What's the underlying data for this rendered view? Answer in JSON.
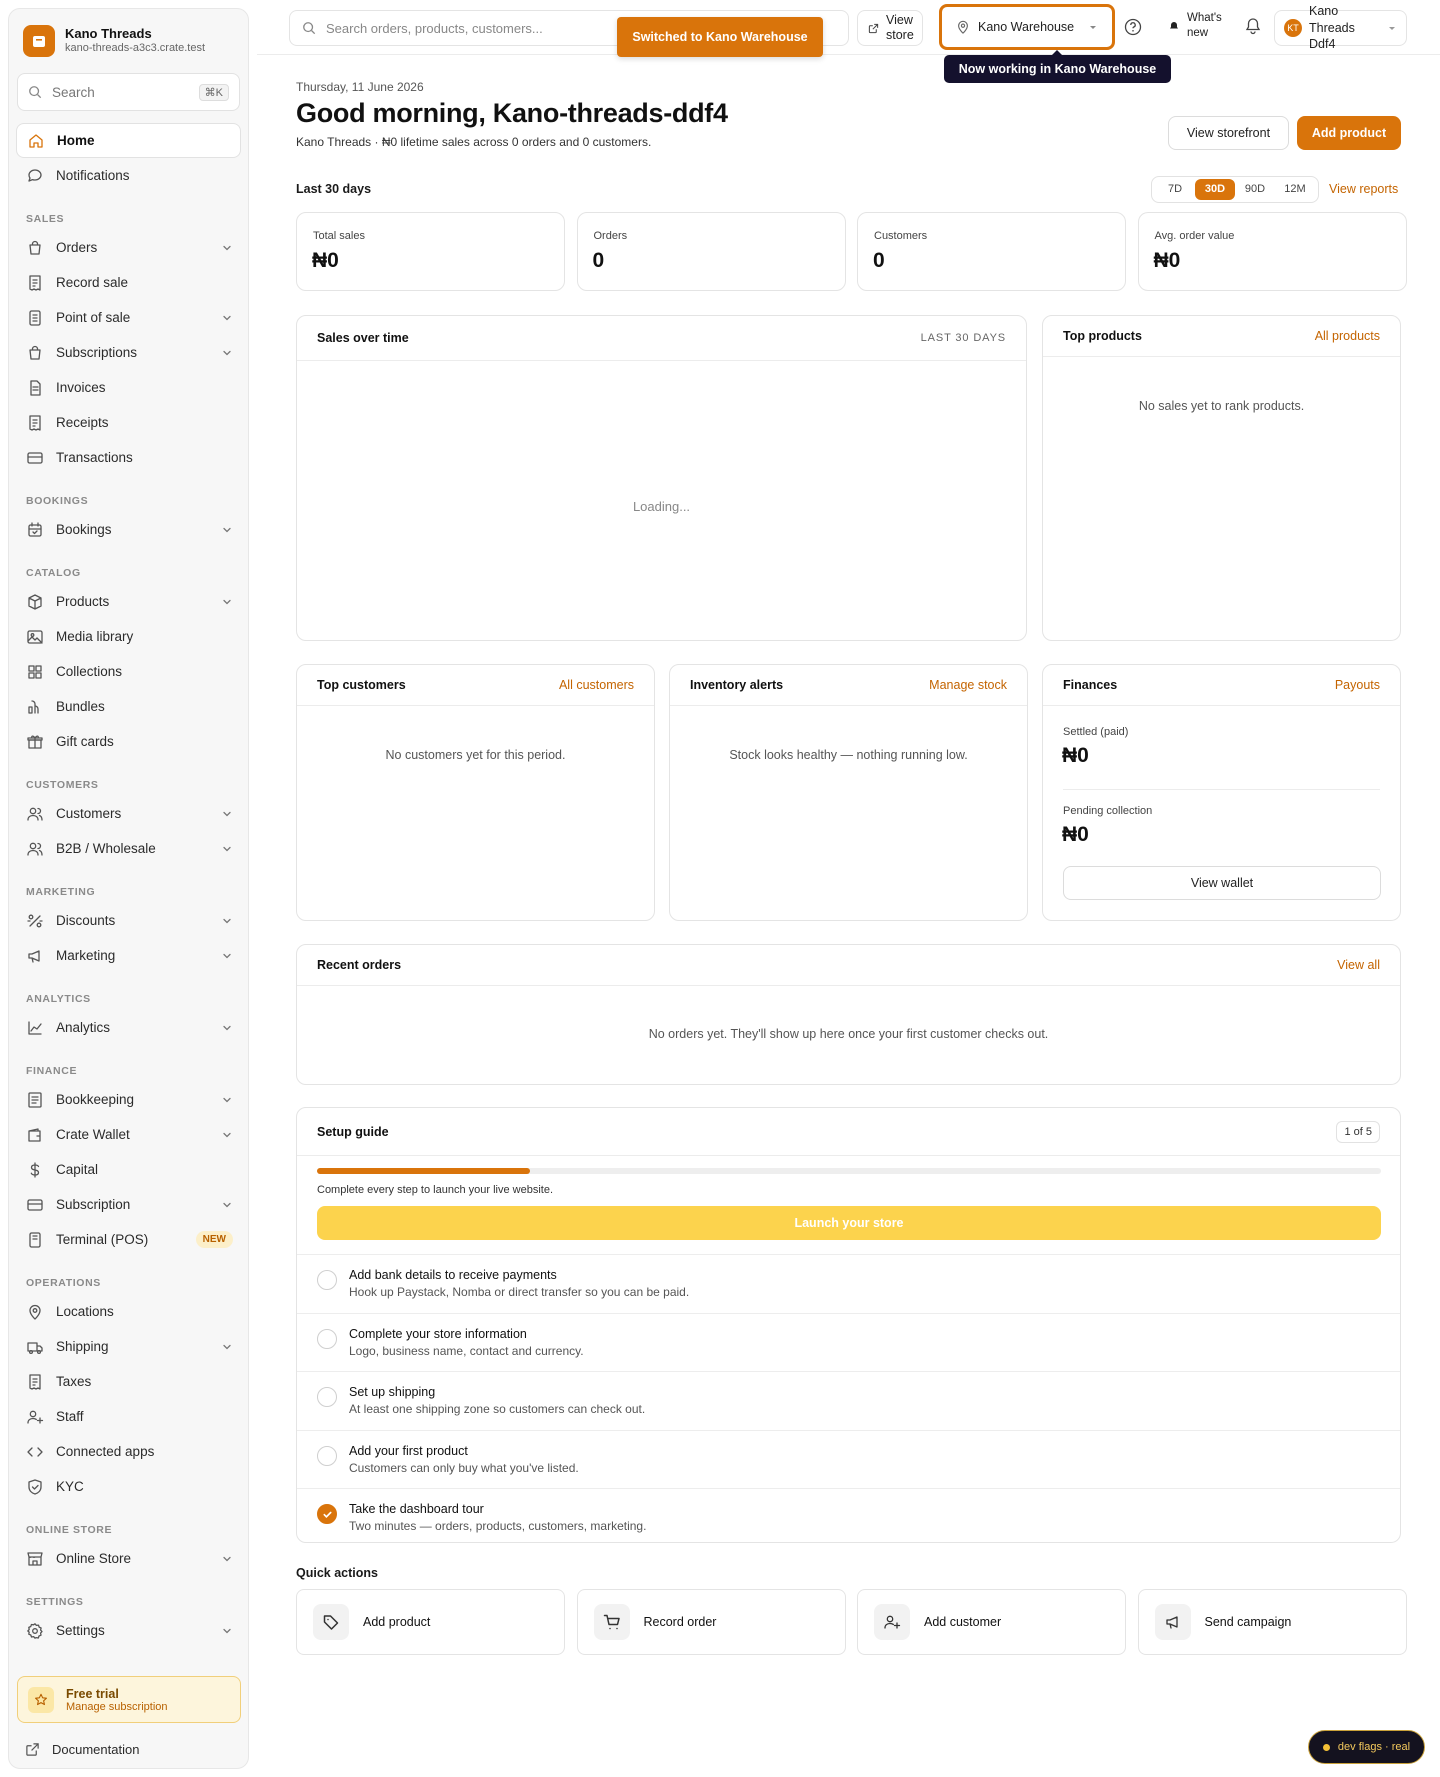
{
  "brand": {
    "name": "Kano Threads",
    "domain": "kano-threads-a3c3.crate.test"
  },
  "sidebar_search": {
    "label": "Search",
    "shortcut": "⌘K"
  },
  "nav_top": [
    {
      "label": "Home",
      "icon": "home-icon",
      "active": true
    },
    {
      "label": "Notifications",
      "icon": "bell-message-icon"
    }
  ],
  "sections": [
    {
      "title": "SALES",
      "items": [
        {
          "label": "Orders",
          "icon": "bag-icon",
          "chev": true
        },
        {
          "label": "Record sale",
          "icon": "receipt-icon"
        },
        {
          "label": "Point of sale",
          "icon": "pos-icon",
          "chev": true
        },
        {
          "label": "Subscriptions",
          "icon": "subscriptions-icon",
          "chev": true
        },
        {
          "label": "Invoices",
          "icon": "document-icon"
        },
        {
          "label": "Receipts",
          "icon": "receipt-icon"
        },
        {
          "label": "Transactions",
          "icon": "card-icon"
        }
      ]
    },
    {
      "title": "BOOKINGS",
      "items": [
        {
          "label": "Bookings",
          "icon": "calendar-icon",
          "chev": true
        }
      ]
    },
    {
      "title": "CATALOG",
      "items": [
        {
          "label": "Products",
          "icon": "box-icon",
          "chev": true
        },
        {
          "label": "Media library",
          "icon": "image-icon"
        },
        {
          "label": "Collections",
          "icon": "grid-icon"
        },
        {
          "label": "Bundles",
          "icon": "bundle-icon"
        },
        {
          "label": "Gift cards",
          "icon": "gift-icon"
        }
      ]
    },
    {
      "title": "CUSTOMERS",
      "items": [
        {
          "label": "Customers",
          "icon": "users-icon",
          "chev": true
        },
        {
          "label": "B2B / Wholesale",
          "icon": "users-icon",
          "chev": true
        }
      ]
    },
    {
      "title": "MARKETING",
      "items": [
        {
          "label": "Discounts",
          "icon": "percent-icon",
          "chev": true
        },
        {
          "label": "Marketing",
          "icon": "megaphone-icon",
          "chev": true
        }
      ]
    },
    {
      "title": "ANALYTICS",
      "items": [
        {
          "label": "Analytics",
          "icon": "chart-icon",
          "chev": true
        }
      ]
    },
    {
      "title": "FINANCE",
      "items": [
        {
          "label": "Bookkeeping",
          "icon": "ledger-icon",
          "chev": true
        },
        {
          "label": "Crate Wallet",
          "icon": "wallet-icon",
          "chev": true
        },
        {
          "label": "Capital",
          "icon": "dollar-icon"
        },
        {
          "label": "Subscription",
          "icon": "card-icon",
          "chev": true
        },
        {
          "label": "Terminal (POS)",
          "icon": "terminal-icon",
          "badge": "NEW"
        }
      ]
    },
    {
      "title": "OPERATIONS",
      "items": [
        {
          "label": "Locations",
          "icon": "pin-icon"
        },
        {
          "label": "Shipping",
          "icon": "truck-icon",
          "chev": true
        },
        {
          "label": "Taxes",
          "icon": "receipt-icon"
        },
        {
          "label": "Staff",
          "icon": "user-plus-icon"
        },
        {
          "label": "Connected apps",
          "icon": "code-icon"
        },
        {
          "label": "KYC",
          "icon": "shield-icon"
        }
      ]
    },
    {
      "title": "ONLINE STORE",
      "items": [
        {
          "label": "Online Store",
          "icon": "store-icon",
          "chev": true
        }
      ]
    },
    {
      "title": "SETTINGS",
      "items": [
        {
          "label": "Settings",
          "icon": "gear-icon",
          "chev": true
        }
      ]
    }
  ],
  "trial": {
    "title": "Free trial",
    "subtitle": "Manage subscription"
  },
  "docs_label": "Documentation",
  "topbar": {
    "search_placeholder": "Search orders, products, customers...",
    "view_store": "View store",
    "location": "Kano Warehouse",
    "whats_new": "What's new",
    "account_initials": "KT",
    "account_name": "Kano Threads Ddf4"
  },
  "toast": "Switched to Kano Warehouse",
  "tooltip": "Now working in Kano Warehouse",
  "header": {
    "date": "Thursday, 11 June 2026",
    "greeting": "Good morning, Kano-threads-ddf4",
    "subtitle": "Kano Threads · ₦0 lifetime sales across 0 orders and 0 customers.",
    "view_storefront": "View storefront",
    "add_product": "Add product"
  },
  "period": {
    "title": "Last 30 days",
    "options": [
      "7D",
      "30D",
      "90D",
      "12M"
    ],
    "selected": "30D",
    "reports_link": "View reports"
  },
  "stats": [
    {
      "label": "Total sales",
      "value": "₦0"
    },
    {
      "label": "Orders",
      "value": "0"
    },
    {
      "label": "Customers",
      "value": "0"
    },
    {
      "label": "Avg. order value",
      "value": "₦0"
    }
  ],
  "sales_chart": {
    "title": "Sales over time",
    "range": "LAST 30 DAYS",
    "status": "Loading..."
  },
  "top_products": {
    "title": "Top products",
    "link": "All products",
    "empty": "No sales yet to rank products."
  },
  "top_customers": {
    "title": "Top customers",
    "link": "All customers",
    "empty": "No customers yet for this period."
  },
  "inventory": {
    "title": "Inventory alerts",
    "link": "Manage stock",
    "empty": "Stock looks healthy — nothing running low."
  },
  "finances": {
    "title": "Finances",
    "link": "Payouts",
    "settled_label": "Settled (paid)",
    "settled_value": "₦0",
    "pending_label": "Pending collection",
    "pending_value": "₦0",
    "wallet_button": "View wallet"
  },
  "recent_orders": {
    "title": "Recent orders",
    "link": "View all",
    "empty": "No orders yet. They'll show up here once your first customer checks out."
  },
  "setup": {
    "title": "Setup guide",
    "count": "1 of 5",
    "progress": 0.2,
    "hint": "Complete every step to launch your live website.",
    "launch": "Launch your store",
    "steps": [
      {
        "title": "Add bank details to receive payments",
        "desc": "Hook up Paystack, Nomba or direct transfer so you can be paid.",
        "done": false
      },
      {
        "title": "Complete your store information",
        "desc": "Logo, business name, contact and currency.",
        "done": false
      },
      {
        "title": "Set up shipping",
        "desc": "At least one shipping zone so customers can check out.",
        "done": false
      },
      {
        "title": "Add your first product",
        "desc": "Customers can only buy what you've listed.",
        "done": false
      },
      {
        "title": "Take the dashboard tour",
        "desc": "Two minutes — orders, products, customers, marketing.",
        "done": true
      }
    ]
  },
  "quick_actions": {
    "title": "Quick actions",
    "items": [
      {
        "label": "Add product",
        "icon": "tag-icon"
      },
      {
        "label": "Record order",
        "icon": "cart-icon"
      },
      {
        "label": "Add customer",
        "icon": "user-plus-icon"
      },
      {
        "label": "Send campaign",
        "icon": "megaphone-icon"
      }
    ]
  },
  "dev_flags": "dev flags · real",
  "colors": {
    "accent": "#d9740b",
    "launch": "#fcd34d",
    "tooltip": "#14112d"
  }
}
